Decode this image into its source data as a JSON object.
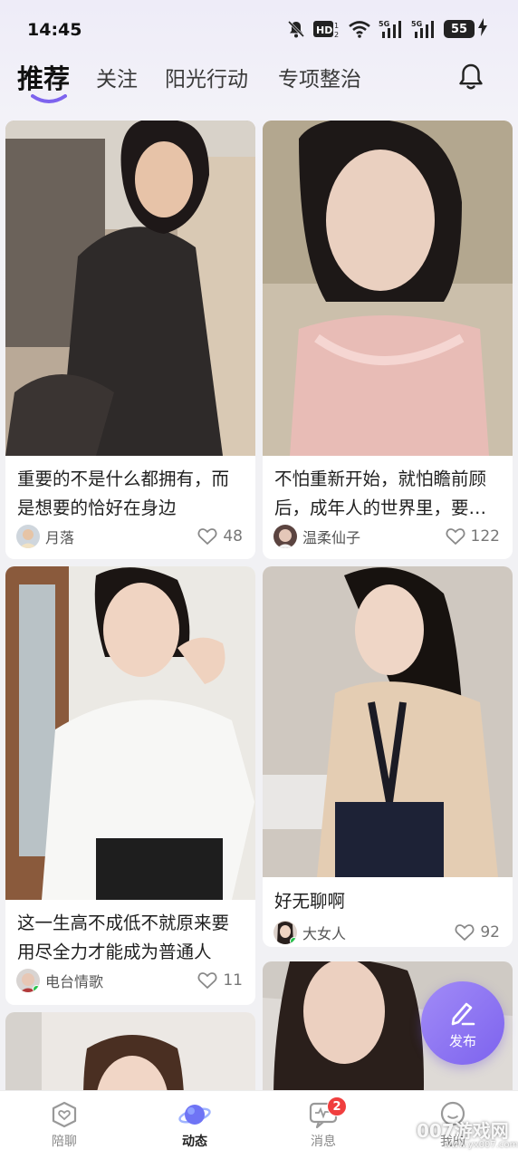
{
  "status_bar": {
    "time": "14:45",
    "hd_label": "HD",
    "network_1": "5G",
    "network_2": "5G",
    "battery": "55"
  },
  "top_tabs": [
    {
      "label": "推荐",
      "active": true
    },
    {
      "label": "关注",
      "active": false
    },
    {
      "label": "阳光行动",
      "active": false
    },
    {
      "label": "专项整治",
      "active": false
    }
  ],
  "posts": [
    {
      "title": "重要的不是什么都拥有，而是想要的恰好在身边",
      "author": "月落",
      "likes": "48"
    },
    {
      "title": "不怕重新开始，就怕瞻前顾后，成年人的世界里，要…",
      "author": "温柔仙子",
      "likes": "122"
    },
    {
      "title": "这一生高不成低不就原来要用尽全力才能成为普通人",
      "author": "电台情歌",
      "likes": "11"
    },
    {
      "title": "好无聊啊",
      "author": "大女人",
      "likes": "92"
    }
  ],
  "fab": {
    "label": "发布",
    "icon": "pen-edit-icon"
  },
  "bottom_nav": [
    {
      "label": "陪聊",
      "icon": "heart-chat-icon",
      "active": false
    },
    {
      "label": "动态",
      "icon": "planet-icon",
      "active": true
    },
    {
      "label": "消息",
      "icon": "message-wave-icon",
      "active": false,
      "badge": "2"
    },
    {
      "label": "我的",
      "icon": "smile-user-icon",
      "active": false
    }
  ],
  "watermark": {
    "text": "007游戏网",
    "sub": "www.yx007.com"
  },
  "colors": {
    "accent": "#7d63ee",
    "badge": "#f03e3e",
    "online": "#27c24c"
  }
}
